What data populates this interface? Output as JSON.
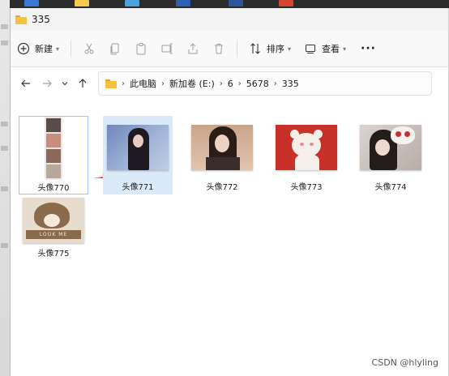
{
  "window": {
    "title": "335"
  },
  "toolbar": {
    "new_label": "新建",
    "sort_label": "排序",
    "view_label": "查看",
    "more_label": "···"
  },
  "breadcrumb": [
    "此电脑",
    "新加卷 (E:)",
    "6",
    "5678",
    "335"
  ],
  "files": [
    {
      "name": "头像770",
      "state": "selected"
    },
    {
      "name": "头像771",
      "state": "hover"
    },
    {
      "name": "头像772",
      "state": ""
    },
    {
      "name": "头像773",
      "state": ""
    },
    {
      "name": "头像774",
      "state": ""
    },
    {
      "name": "头像775",
      "state": ""
    }
  ],
  "thumb_text": {
    "t775": "LOOK ME"
  },
  "watermark": "CSDN @hlyling",
  "colors": {
    "accent_selection": "#99c9f5",
    "hover_bg": "#dbeaf9",
    "folder": "#f7c13c",
    "arrow": "#e5342a"
  }
}
